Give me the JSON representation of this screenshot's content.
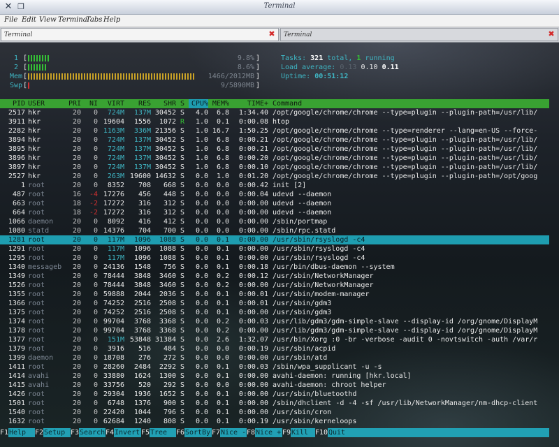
{
  "window": {
    "title": "Terminal"
  },
  "menu": [
    "File",
    "Edit",
    "View",
    "Terminal",
    "Tabs",
    "Help"
  ],
  "tabs": [
    {
      "label": "Terminal",
      "active": true
    },
    {
      "label": "Terminal",
      "active": false
    }
  ],
  "meters": [
    {
      "label": "1",
      "value": "9.8%",
      "fraction": 0.098,
      "color": "#35c135"
    },
    {
      "label": "2",
      "value": "8.6%",
      "fraction": 0.086,
      "color": "#35c135"
    },
    {
      "label": "Mem",
      "value": "1466/2012MB",
      "fraction": 0.73,
      "color": "#c9a226"
    },
    {
      "label": "Swp",
      "value": "9/5890MB",
      "fraction": 0.0015,
      "color": "#d03030"
    }
  ],
  "summary": {
    "tasks_label": "Tasks:",
    "tasks_total": "321",
    "tasks_total_word": "total,",
    "tasks_running": "1",
    "tasks_running_word": "running",
    "load_label": "Load average:",
    "load_1": "0.13",
    "load_5": "0.10",
    "load_15": "0.11",
    "uptime_label": "Uptime:",
    "uptime": "00:51:12"
  },
  "columns": [
    "PID",
    "USER",
    "PRI",
    "NI",
    "VIRT",
    "RES",
    "SHR",
    "S",
    "CPU%",
    "MEM%",
    "TIME+",
    "Command"
  ],
  "processes": [
    [
      "2517",
      "hkr",
      "20",
      "0",
      "724M",
      "137M",
      "30452",
      "S",
      "4.0",
      "6.8",
      "1:34.40",
      "/opt/google/chrome/chrome --type=plugin --plugin-path=/usr/lib/"
    ],
    [
      "3911",
      "hkr",
      "20",
      "0",
      "19604",
      "1556",
      "1072",
      "R",
      "1.0",
      "0.1",
      "0:00.08",
      "htop"
    ],
    [
      "2282",
      "hkr",
      "20",
      "0",
      "1163M",
      "336M",
      "21356",
      "S",
      "1.0",
      "16.7",
      "1:50.25",
      "/opt/google/chrome/chrome --type=renderer --lang=en-US --force-"
    ],
    [
      "3894",
      "hkr",
      "20",
      "0",
      "724M",
      "137M",
      "30452",
      "S",
      "1.0",
      "6.8",
      "0:00.21",
      "/opt/google/chrome/chrome --type=plugin --plugin-path=/usr/lib/"
    ],
    [
      "3895",
      "hkr",
      "20",
      "0",
      "724M",
      "137M",
      "30452",
      "S",
      "1.0",
      "6.8",
      "0:00.21",
      "/opt/google/chrome/chrome --type=plugin --plugin-path=/usr/lib/"
    ],
    [
      "3896",
      "hkr",
      "20",
      "0",
      "724M",
      "137M",
      "30452",
      "S",
      "1.0",
      "6.8",
      "0:00.20",
      "/opt/google/chrome/chrome --type=plugin --plugin-path=/usr/lib/"
    ],
    [
      "3897",
      "hkr",
      "20",
      "0",
      "724M",
      "137M",
      "30452",
      "S",
      "1.0",
      "6.8",
      "0:00.10",
      "/opt/google/chrome/chrome --type=plugin --plugin-path=/usr/lib/"
    ],
    [
      "2527",
      "hkr",
      "20",
      "0",
      "263M",
      "19600",
      "14632",
      "S",
      "0.0",
      "1.0",
      "0:01.20",
      "/opt/google/chrome/chrome --type=plugin --plugin-path=/opt/goog"
    ],
    [
      "1",
      "root",
      "20",
      "0",
      "8352",
      "708",
      "668",
      "S",
      "0.0",
      "0.0",
      "0:00.42",
      "init [2]"
    ],
    [
      "487",
      "root",
      "16",
      "-4",
      "17276",
      "456",
      "448",
      "S",
      "0.0",
      "0.0",
      "0:00.04",
      "udevd --daemon"
    ],
    [
      "663",
      "root",
      "18",
      "-2",
      "17272",
      "316",
      "312",
      "S",
      "0.0",
      "0.0",
      "0:00.00",
      "udevd --daemon"
    ],
    [
      "664",
      "root",
      "18",
      "-2",
      "17272",
      "316",
      "312",
      "S",
      "0.0",
      "0.0",
      "0:00.00",
      "udevd --daemon"
    ],
    [
      "1066",
      "daemon",
      "20",
      "0",
      "8092",
      "416",
      "412",
      "S",
      "0.0",
      "0.0",
      "0:00.00",
      "/sbin/portmap"
    ],
    [
      "1080",
      "statd",
      "20",
      "0",
      "14376",
      "704",
      "700",
      "S",
      "0.0",
      "0.0",
      "0:00.00",
      "/sbin/rpc.statd"
    ],
    [
      "1281",
      "root",
      "20",
      "0",
      "117M",
      "1096",
      "1088",
      "S",
      "0.0",
      "0.1",
      "0:00.00",
      "/usr/sbin/rsyslogd -c4"
    ],
    [
      "1291",
      "root",
      "20",
      "0",
      "117M",
      "1096",
      "1088",
      "S",
      "0.0",
      "0.1",
      "0:00.00",
      "/usr/sbin/rsyslogd -c4"
    ],
    [
      "1295",
      "root",
      "20",
      "0",
      "117M",
      "1096",
      "1088",
      "S",
      "0.0",
      "0.1",
      "0:00.00",
      "/usr/sbin/rsyslogd -c4"
    ],
    [
      "1340",
      "messageb",
      "20",
      "0",
      "24136",
      "1548",
      "756",
      "S",
      "0.0",
      "0.1",
      "0:00.18",
      "/usr/bin/dbus-daemon --system"
    ],
    [
      "1349",
      "root",
      "20",
      "0",
      "78444",
      "3848",
      "3460",
      "S",
      "0.0",
      "0.2",
      "0:00.12",
      "/usr/sbin/NetworkManager"
    ],
    [
      "1526",
      "root",
      "20",
      "0",
      "78444",
      "3848",
      "3460",
      "S",
      "0.0",
      "0.2",
      "0:00.00",
      "/usr/sbin/NetworkManager"
    ],
    [
      "1355",
      "root",
      "20",
      "0",
      "59888",
      "2044",
      "2036",
      "S",
      "0.0",
      "0.1",
      "0:00.01",
      "/usr/sbin/modem-manager"
    ],
    [
      "1366",
      "root",
      "20",
      "0",
      "74252",
      "2516",
      "2508",
      "S",
      "0.0",
      "0.1",
      "0:00.01",
      "/usr/sbin/gdm3"
    ],
    [
      "1375",
      "root",
      "20",
      "0",
      "74252",
      "2516",
      "2508",
      "S",
      "0.0",
      "0.1",
      "0:00.00",
      "/usr/sbin/gdm3"
    ],
    [
      "1374",
      "root",
      "20",
      "0",
      "99704",
      "3768",
      "3368",
      "S",
      "0.0",
      "0.2",
      "0:00.03",
      "/usr/lib/gdm3/gdm-simple-slave --display-id /org/gnome/DisplayM"
    ],
    [
      "1378",
      "root",
      "20",
      "0",
      "99704",
      "3768",
      "3368",
      "S",
      "0.0",
      "0.2",
      "0:00.00",
      "/usr/lib/gdm3/gdm-simple-slave --display-id /org/gnome/DisplayM"
    ],
    [
      "1377",
      "root",
      "20",
      "0",
      "151M",
      "53848",
      "31384",
      "S",
      "0.0",
      "2.6",
      "1:32.07",
      "/usr/bin/Xorg :0 -br -verbose -audit 0 -novtswitch -auth /var/r"
    ],
    [
      "1379",
      "root",
      "20",
      "0",
      "3916",
      "516",
      "484",
      "S",
      "0.0",
      "0.0",
      "0:00.19",
      "/usr/sbin/acpid"
    ],
    [
      "1399",
      "daemon",
      "20",
      "0",
      "18708",
      "276",
      "272",
      "S",
      "0.0",
      "0.0",
      "0:00.00",
      "/usr/sbin/atd"
    ],
    [
      "1411",
      "root",
      "20",
      "0",
      "28260",
      "2484",
      "2292",
      "S",
      "0.0",
      "0.1",
      "0:00.03",
      "/sbin/wpa_supplicant -u -s"
    ],
    [
      "1414",
      "avahi",
      "20",
      "0",
      "33880",
      "1624",
      "1300",
      "S",
      "0.0",
      "0.1",
      "0:00.00",
      "avahi-daemon: running [hkr.local]"
    ],
    [
      "1415",
      "avahi",
      "20",
      "0",
      "33756",
      "520",
      "292",
      "S",
      "0.0",
      "0.0",
      "0:00.00",
      "avahi-daemon: chroot helper"
    ],
    [
      "1426",
      "root",
      "20",
      "0",
      "29304",
      "1936",
      "1652",
      "S",
      "0.0",
      "0.1",
      "0:00.00",
      "/usr/sbin/bluetoothd"
    ],
    [
      "1501",
      "root",
      "20",
      "0",
      "6748",
      "1376",
      "900",
      "S",
      "0.0",
      "0.1",
      "0:00.00",
      "/sbin/dhclient -d -4 -sf /usr/lib/NetworkManager/nm-dhcp-client"
    ],
    [
      "1540",
      "root",
      "20",
      "0",
      "22420",
      "1044",
      "796",
      "S",
      "0.0",
      "0.1",
      "0:00.00",
      "/usr/sbin/cron"
    ],
    [
      "1632",
      "root",
      "20",
      "0",
      "62684",
      "1240",
      "808",
      "S",
      "0.0",
      "0.1",
      "0:00.19",
      "/usr/sbin/kerneloops"
    ]
  ],
  "selected_pid": "1281",
  "function_keys": [
    {
      "key": "F1",
      "label": "Help"
    },
    {
      "key": "F2",
      "label": "Setup"
    },
    {
      "key": "F3",
      "label": "Search"
    },
    {
      "key": "F4",
      "label": "Invert"
    },
    {
      "key": "F5",
      "label": "Tree"
    },
    {
      "key": "F6",
      "label": "SortBy"
    },
    {
      "key": "F7",
      "label": "Nice -"
    },
    {
      "key": "F8",
      "label": "Nice +"
    },
    {
      "key": "F9",
      "label": "Kill"
    },
    {
      "key": "F10",
      "label": "Quit"
    }
  ],
  "colors": {
    "header_bg": "#39a232",
    "selection_bg": "#1e9db0",
    "meter_label": "#3fb6c4",
    "user_default": "#eaeaea",
    "user_system": "#7d8794",
    "virt_large": "#3fb6c4",
    "nice_negative": "#d03030",
    "running_state": "#35c135",
    "fkey_bg": "#21a0b4"
  }
}
